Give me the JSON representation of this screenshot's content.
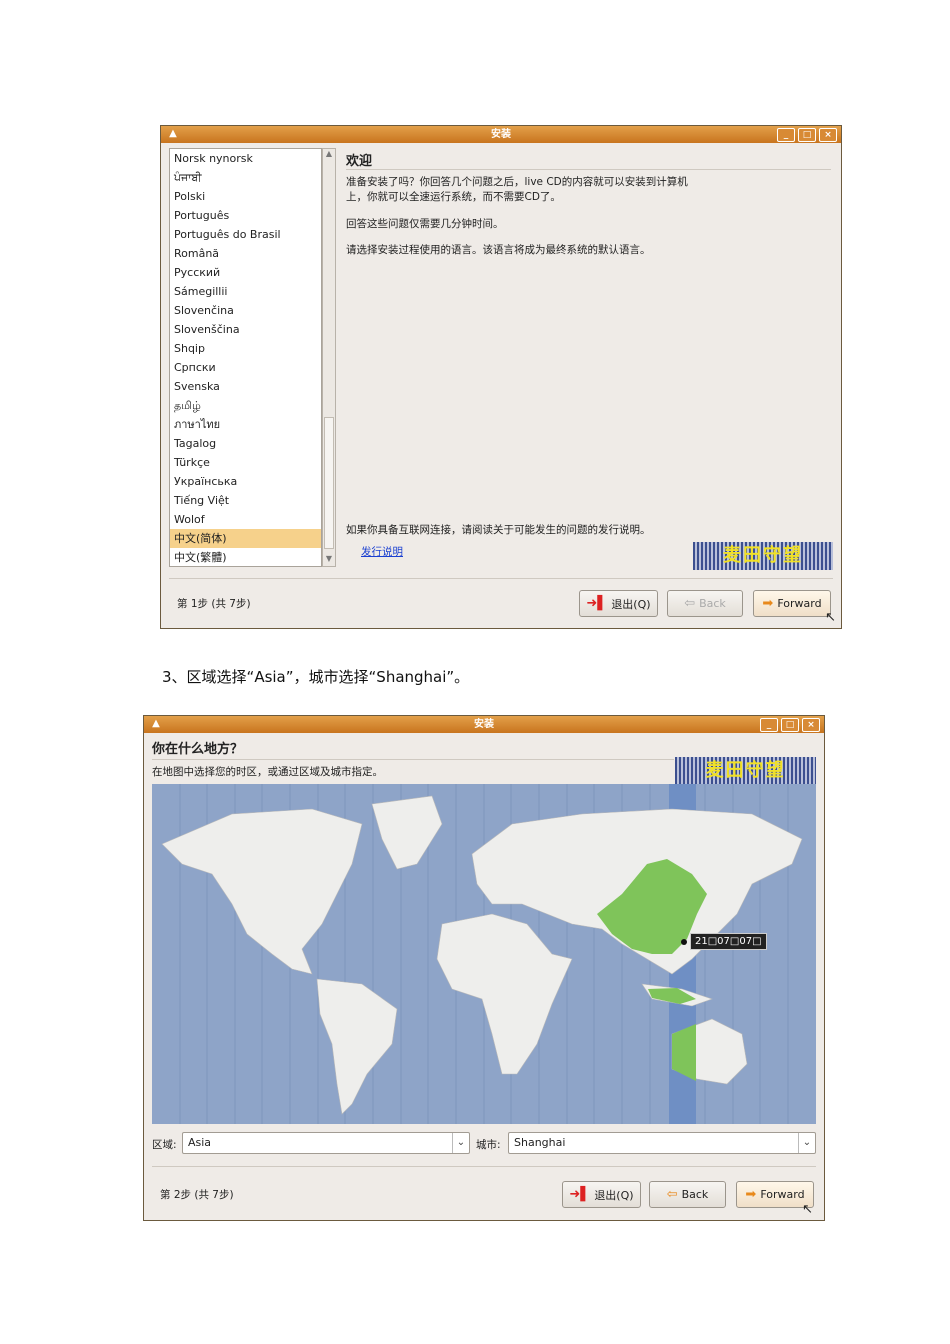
{
  "window1": {
    "title": "安装",
    "languages": [
      "Norsk nynorsk",
      "ਪੰਜਾਬੀ",
      "Polski",
      "Português",
      "Português do Brasil",
      "Română",
      "Русский",
      "Sámegillii",
      "Slovenčina",
      "Slovenščina",
      "Shqip",
      "Српски",
      "Svenska",
      "தமிழ்",
      "ภาษาไทย",
      "Tagalog",
      "Türkçe",
      "Українська",
      "Tiếng Việt",
      "Wolof",
      "中文(简体)",
      "中文(繁體)"
    ],
    "selected_language": "中文(简体)",
    "heading": "欢迎",
    "para1": "准备安装了吗？你回答几个问题之后，live CD的内容就可以安装到计算机上，你就可以全速运行系统，而不需要CD了。",
    "para2": "回答这些问题仅需要几分钟时间。",
    "para3": "请选择安装过程使用的语言。该语言将成为最终系统的默认语言。",
    "para4": "如果你具备互联网连接，请阅读关于可能发生的问题的发行说明。",
    "release_notes_link": "发行说明",
    "banner": "麦田守望",
    "step": "第 1步 (共 7步)",
    "quit": "退出(Q)",
    "back": "Back",
    "forward": "Forward"
  },
  "caption": "3、区域选择“Asia”，城市选择“Shanghai”。",
  "window2": {
    "title": "安装",
    "heading": "你在什么地方？",
    "subtitle": "在地图中选择您的时区，或通过区域及城市指定。",
    "banner": "麦田守望",
    "time_tooltip": "21□07□07□",
    "region_label": "区域:",
    "region_value": "Asia",
    "city_label": "城市:",
    "city_value": "Shanghai",
    "step": "第 2步 (共 7步)",
    "quit": "退出(Q)",
    "back": "Back",
    "forward": "Forward"
  },
  "colors": {
    "titlebar": "#d8872f",
    "map_ocean": "#8ea4c8",
    "land": "#eeeeec",
    "selected_zone": "#7fc45a"
  }
}
